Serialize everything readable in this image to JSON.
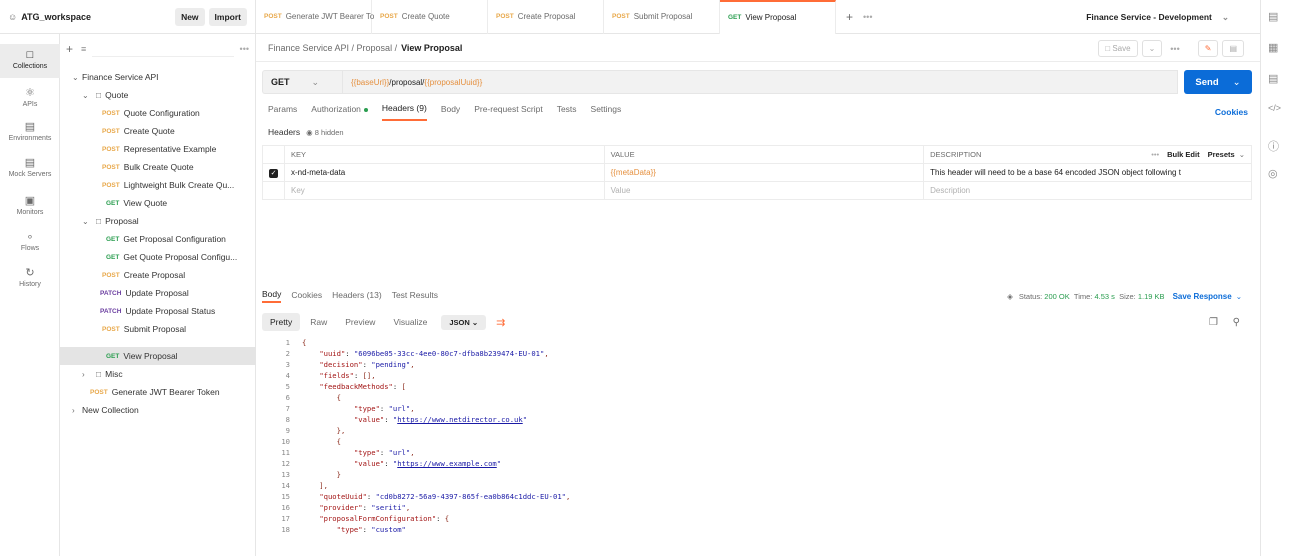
{
  "workspace": {
    "name": "ATG_workspace",
    "new_label": "New",
    "import_label": "Import"
  },
  "tabs": [
    {
      "method": "POST",
      "label": "Generate JWT Bearer To"
    },
    {
      "method": "POST",
      "label": "Create Quote"
    },
    {
      "method": "POST",
      "label": "Create Proposal"
    },
    {
      "method": "POST",
      "label": "Submit Proposal"
    },
    {
      "method": "GET",
      "label": "View Proposal"
    }
  ],
  "environment": "Finance Service - Development",
  "rail": [
    {
      "label": "Collections"
    },
    {
      "label": "APIs"
    },
    {
      "label": "Environments"
    },
    {
      "label": "Mock Servers"
    },
    {
      "label": "Monitors"
    },
    {
      "label": "Flows"
    },
    {
      "label": "History"
    }
  ],
  "tree": {
    "root": "Finance Service API",
    "quote_folder": "Quote",
    "quote_items": [
      {
        "method": "POST",
        "label": "Quote Configuration"
      },
      {
        "method": "POST",
        "label": "Create Quote"
      },
      {
        "method": "POST",
        "label": "Representative Example"
      },
      {
        "method": "POST",
        "label": "Bulk Create Quote"
      },
      {
        "method": "POST",
        "label": "Lightweight Bulk Create Qu..."
      },
      {
        "method": "GET",
        "label": "View Quote"
      }
    ],
    "proposal_folder": "Proposal",
    "proposal_items": [
      {
        "method": "GET",
        "label": "Get Proposal Configuration"
      },
      {
        "method": "GET",
        "label": "Get Quote Proposal Configu..."
      },
      {
        "method": "POST",
        "label": "Create Proposal"
      },
      {
        "method": "PATCH",
        "label": "Update Proposal"
      },
      {
        "method": "PATCH",
        "label": "Update Proposal Status"
      },
      {
        "method": "POST",
        "label": "Submit Proposal"
      },
      {
        "method": "GET",
        "label": "View Proposal"
      }
    ],
    "misc_folder": "Misc",
    "root_items": [
      {
        "method": "POST",
        "label": "Generate JWT Bearer Token"
      }
    ],
    "new_collection": "New Collection"
  },
  "breadcrumb": {
    "path": "Finance Service API / Proposal /",
    "current": "View Proposal"
  },
  "toolbar": {
    "save": "Save"
  },
  "request": {
    "method": "GET",
    "url_var1": "{{baseUrl}}",
    "url_path": "/proposal/",
    "url_var2": "{{proposalUuid}}",
    "send": "Send"
  },
  "req_tabs": {
    "params": "Params",
    "auth": "Authorization",
    "headers": "Headers (9)",
    "body": "Body",
    "prereq": "Pre-request Script",
    "tests": "Tests",
    "settings": "Settings",
    "cookies": "Cookies"
  },
  "headers_sub": {
    "title": "Headers",
    "hidden": "8 hidden"
  },
  "headers_table": {
    "col_key": "KEY",
    "col_value": "VALUE",
    "col_desc": "DESCRIPTION",
    "bulk_edit": "Bulk Edit",
    "presets": "Presets",
    "row": {
      "key": "x-nd-meta-data",
      "value": "{{metaData}}",
      "desc": "This header will need to be a base 64 encoded JSON object following t"
    },
    "placeholder": {
      "key": "Key",
      "value": "Value",
      "desc": "Description"
    }
  },
  "resp_tabs": {
    "body": "Body",
    "cookies": "Cookies",
    "headers": "Headers (13)",
    "tests": "Test Results"
  },
  "resp_status": {
    "status_label": "Status:",
    "status": "200 OK",
    "time_label": "Time:",
    "time": "4.53 s",
    "size_label": "Size:",
    "size": "1.19 KB",
    "save": "Save Response"
  },
  "view": {
    "pretty": "Pretty",
    "raw": "Raw",
    "preview": "Preview",
    "visualize": "Visualize",
    "format": "JSON"
  },
  "code_lines": [
    "{",
    "    \"uuid\": \"6096be05-33cc-4ee0-80c7-dfba8b239474-EU-01\",",
    "    \"decision\": \"pending\",",
    "    \"fields\": [],",
    "    \"feedbackMethods\": [",
    "        {",
    "            \"type\": \"url\",",
    "            \"value\": \"https://www.netdirector.co.uk\"",
    "        },",
    "        {",
    "            \"type\": \"url\",",
    "            \"value\": \"https://www.example.com\"",
    "        }",
    "    ],",
    "    \"quoteUuid\": \"cd0b8272-56a9-4397-865f-ea0b864c1ddc-EU-01\",",
    "    \"provider\": \"seriti\",",
    "    \"proposalFormConfiguration\": {",
    "        \"type\": \"custom\""
  ]
}
